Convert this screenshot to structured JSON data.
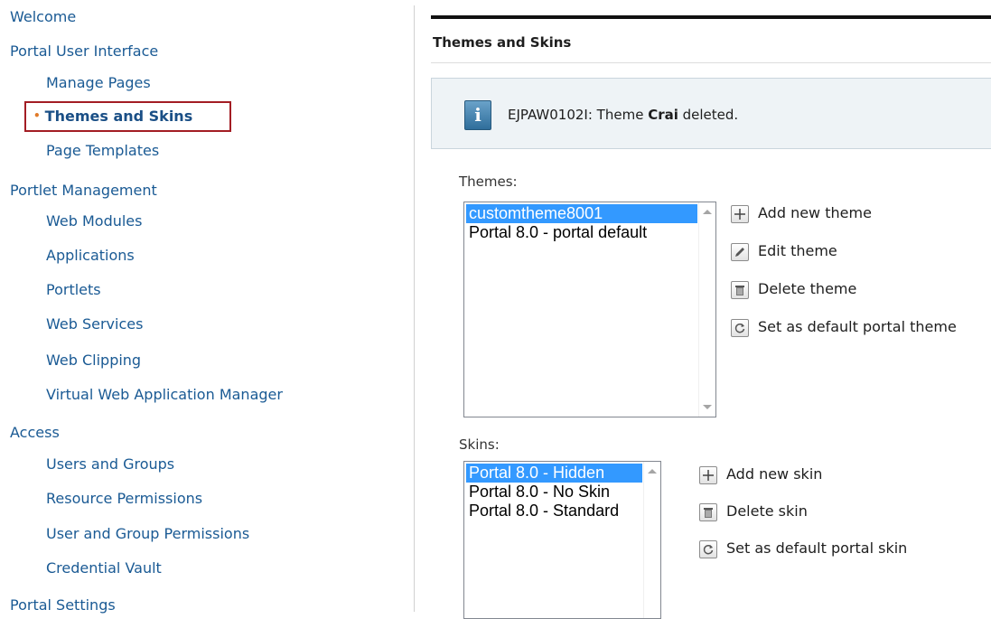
{
  "nav": {
    "items": [
      {
        "label": "Welcome",
        "level": "category"
      },
      {
        "label": "Portal User Interface",
        "level": "category"
      },
      {
        "label": "Manage Pages",
        "level": "sub"
      },
      {
        "label": "Themes and Skins",
        "level": "sub",
        "selected": true
      },
      {
        "label": "Page Templates",
        "level": "sub"
      },
      {
        "label": "Portlet Management",
        "level": "category"
      },
      {
        "label": "Web Modules",
        "level": "sub"
      },
      {
        "label": "Applications",
        "level": "sub"
      },
      {
        "label": "Portlets",
        "level": "sub"
      },
      {
        "label": "Web Services",
        "level": "sub"
      },
      {
        "label": "Web Clipping",
        "level": "sub"
      },
      {
        "label": "Virtual Web Application Manager",
        "level": "sub"
      },
      {
        "label": "Access",
        "level": "category"
      },
      {
        "label": "Users and Groups",
        "level": "sub"
      },
      {
        "label": "Resource Permissions",
        "level": "sub"
      },
      {
        "label": "User and Group Permissions",
        "level": "sub"
      },
      {
        "label": "Credential Vault",
        "level": "sub"
      },
      {
        "label": "Portal Settings",
        "level": "category"
      }
    ],
    "selected_bullet": "•"
  },
  "page": {
    "title": "Themes and Skins"
  },
  "message": {
    "icon": "info-icon",
    "icon_glyph": "i",
    "text_prefix": "EJPAW0102I: Theme ",
    "theme_name": "Crai",
    "text_suffix": " deleted."
  },
  "themes": {
    "label": "Themes:",
    "options": [
      "customtheme8001",
      "Portal 8.0 - portal default"
    ],
    "selected": "customtheme8001",
    "actions": [
      {
        "label": "Add new theme",
        "icon": "add-icon"
      },
      {
        "label": "Edit theme",
        "icon": "edit-icon"
      },
      {
        "label": "Delete theme",
        "icon": "delete-icon"
      },
      {
        "label": "Set as default portal theme",
        "icon": "set-default-icon"
      }
    ]
  },
  "skins": {
    "label": "Skins:",
    "options": [
      "Portal 8.0 - Hidden",
      "Portal 8.0 - No Skin",
      "Portal 8.0 - Standard"
    ],
    "selected": "Portal 8.0 - Hidden",
    "actions": [
      {
        "label": "Add new skin",
        "icon": "add-icon"
      },
      {
        "label": "Delete skin",
        "icon": "delete-icon"
      },
      {
        "label": "Set as default portal skin",
        "icon": "set-default-icon"
      }
    ]
  },
  "colors": {
    "link": "#1a5a94",
    "selection_outline": "#a31d24",
    "bullet": "#e07a28",
    "listbox_selection": "#3399ff",
    "message_bg": "#eef3f6"
  }
}
